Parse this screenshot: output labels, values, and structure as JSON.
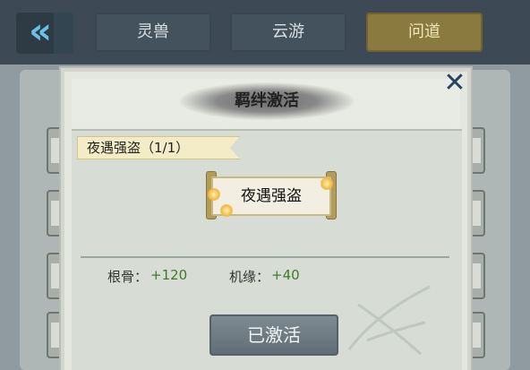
{
  "tabs": [
    {
      "label": "灵兽",
      "active": false
    },
    {
      "label": "云游",
      "active": false
    },
    {
      "label": "问道",
      "active": true
    }
  ],
  "modal": {
    "title": "羁绊激活",
    "bond_tag": "夜遇强盗（1/1）",
    "scroll_title": "夜遇强盗",
    "stats": [
      {
        "label": "根骨：",
        "value": "+120"
      },
      {
        "label": "机缘：",
        "value": "+40"
      }
    ],
    "button_label": "已激活"
  },
  "colors": {
    "accent_gold": "#8a7a40",
    "stat_green": "#3f7a2a",
    "close_icon": "#29445e"
  }
}
